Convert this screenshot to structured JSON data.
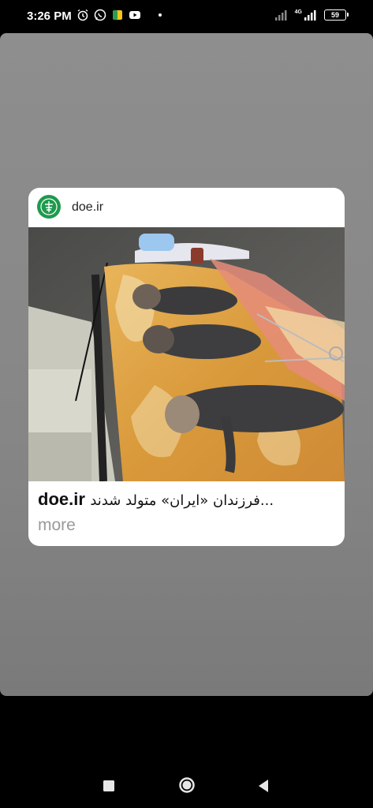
{
  "status_bar": {
    "time": "3:26 PM",
    "battery": "59",
    "network_label": "4G"
  },
  "story_card": {
    "source_name": "doe.ir",
    "footer_domain": "doe.ir",
    "footer_title": "فرزندان «ایران» متولد شدند...",
    "more_label": "more"
  },
  "navigation": {
    "icons": [
      "recent-apps-icon",
      "home-icon",
      "back-icon"
    ]
  }
}
